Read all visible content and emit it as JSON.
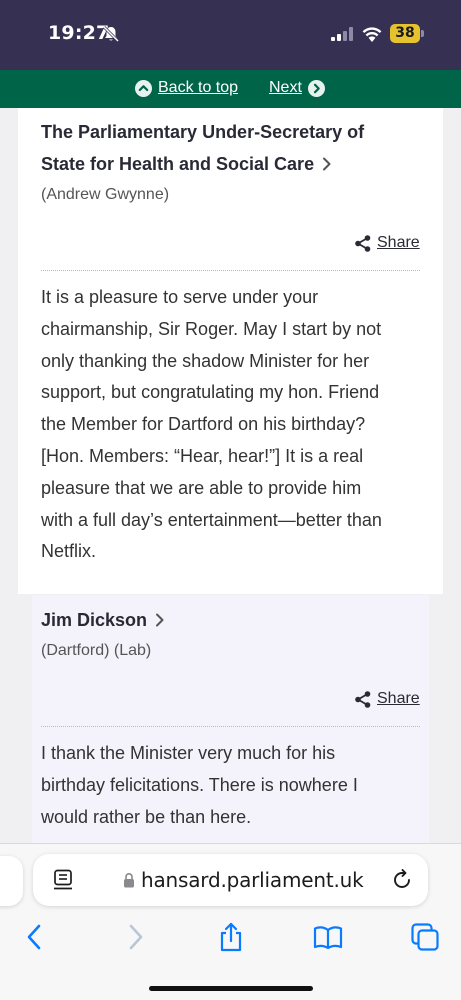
{
  "status_bar": {
    "time": "19:27",
    "battery": "38"
  },
  "nav": {
    "back_label": "Back to top",
    "next_label": "Next"
  },
  "contributions": [
    {
      "speaker_line1": "The Parliamentary Under-Secretary of",
      "speaker_line2": "State for Health and Social Care",
      "speaker_sub": "(Andrew Gwynne)",
      "share_label": "Share",
      "speech_lines": [
        "It is a pleasure to serve under your",
        "chairmanship, Sir Roger. May I start by not",
        "only thanking the shadow Minister for her",
        "support, but congratulating my hon. Friend",
        "the Member for Dartford on his birthday?",
        "[Hon. Members: “Hear, hear!”] It is a real",
        "pleasure that we are able to provide him",
        "with a full day’s entertainment—better than",
        "Netflix."
      ]
    },
    {
      "speaker_line1": "Jim Dickson",
      "speaker_sub": "(Dartford) (Lab)",
      "share_label": "Share",
      "speech_lines": [
        "I thank the Minister very much for his",
        "birthday felicitations. There is nowhere I",
        "would rather be than here."
      ]
    }
  ],
  "browser": {
    "url": "hansard.parliament.uk",
    "icons": [
      "reader-icon",
      "lock-icon",
      "reload-icon",
      "back-icon",
      "forward-icon",
      "share-icon",
      "bookmarks-icon",
      "tabs-icon"
    ]
  },
  "colors": {
    "status_bar_bg": "#363052",
    "nav_green": "#006548",
    "battery": "#e6c32e",
    "link_blue": "#0a7aff"
  }
}
